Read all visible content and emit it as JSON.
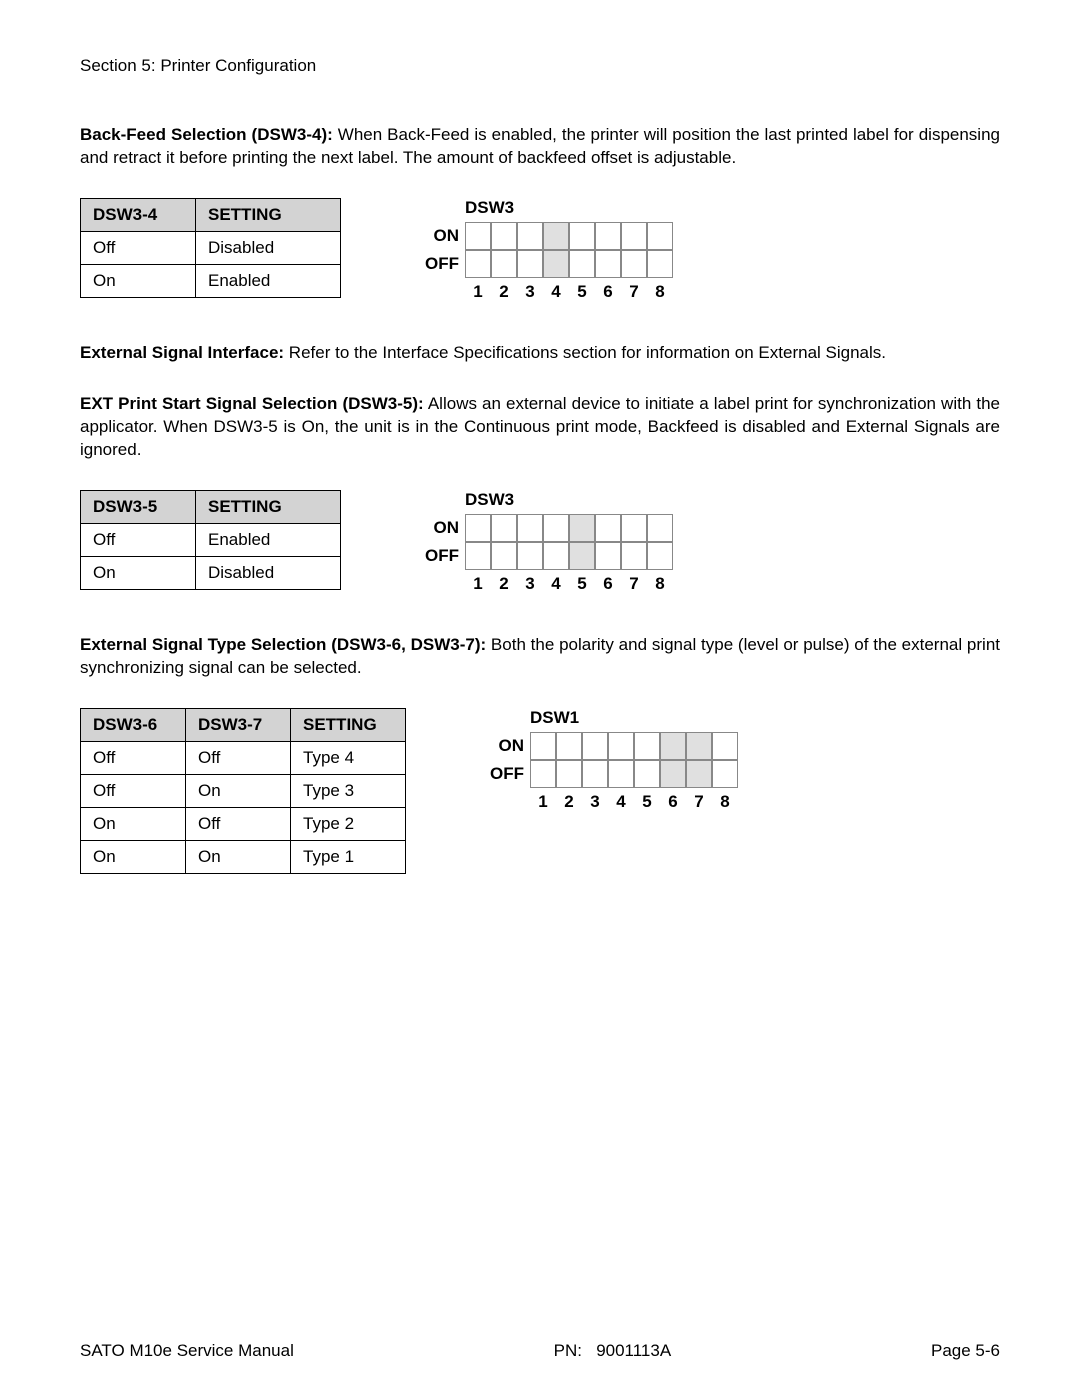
{
  "header": "Section 5: Printer Configuration",
  "section1": {
    "title": "Back-Feed Selection (DSW3-4):",
    "body": " When Back-Feed is enabled, the printer will position the last printed label for dispensing and retract it before printing the next label. The amount of backfeed offset is adjustable.",
    "table": {
      "headers": [
        "DSW3-4",
        "SETTING"
      ],
      "rows": [
        [
          "Off",
          "Disabled"
        ],
        [
          "On",
          "Enabled"
        ]
      ]
    },
    "dip": {
      "label": "DSW3",
      "on": "ON",
      "off": "OFF",
      "nums": [
        "1",
        "2",
        "3",
        "4",
        "5",
        "6",
        "7",
        "8"
      ],
      "shaded_top": [
        false,
        false,
        false,
        true,
        false,
        false,
        false,
        false
      ],
      "shaded_bottom": [
        false,
        false,
        false,
        true,
        false,
        false,
        false,
        false
      ]
    }
  },
  "section2": {
    "title": "External Signal Interface:",
    "body": " Refer to the Interface Specifications section for information on External Signals."
  },
  "section3": {
    "title": "EXT Print Start Signal Selection (DSW3-5):",
    "body": " Allows an external device to initiate a label print for synchronization with the applicator. When DSW3-5 is On, the unit is in the Continuous print mode, Backfeed is disabled and External Signals are ignored.",
    "table": {
      "headers": [
        "DSW3-5",
        "SETTING"
      ],
      "rows": [
        [
          "Off",
          "Enabled"
        ],
        [
          "On",
          "Disabled"
        ]
      ]
    },
    "dip": {
      "label": "DSW3",
      "on": "ON",
      "off": "OFF",
      "nums": [
        "1",
        "2",
        "3",
        "4",
        "5",
        "6",
        "7",
        "8"
      ],
      "shaded_top": [
        false,
        false,
        false,
        false,
        true,
        false,
        false,
        false
      ],
      "shaded_bottom": [
        false,
        false,
        false,
        false,
        true,
        false,
        false,
        false
      ]
    }
  },
  "section4": {
    "title": "External Signal Type Selection (DSW3-6, DSW3-7):",
    "body": " Both the polarity and signal type (level or pulse) of the external print synchronizing signal can be selected.",
    "table": {
      "headers": [
        "DSW3-6",
        "DSW3-7",
        "SETTING"
      ],
      "rows": [
        [
          "Off",
          "Off",
          "Type 4"
        ],
        [
          "Off",
          "On",
          "Type 3"
        ],
        [
          "On",
          "Off",
          "Type 2"
        ],
        [
          "On",
          "On",
          "Type 1"
        ]
      ]
    },
    "dip": {
      "label": "DSW1",
      "on": "ON",
      "off": "OFF",
      "nums": [
        "1",
        "2",
        "3",
        "4",
        "5",
        "6",
        "7",
        "8"
      ],
      "shaded_top": [
        false,
        false,
        false,
        false,
        false,
        true,
        true,
        false
      ],
      "shaded_bottom": [
        false,
        false,
        false,
        false,
        false,
        true,
        true,
        false
      ]
    }
  },
  "footer": {
    "left": "SATO M10e Service Manual",
    "pn_label": "PN:",
    "pn_value": "9001113A",
    "right": "Page 5-6"
  }
}
